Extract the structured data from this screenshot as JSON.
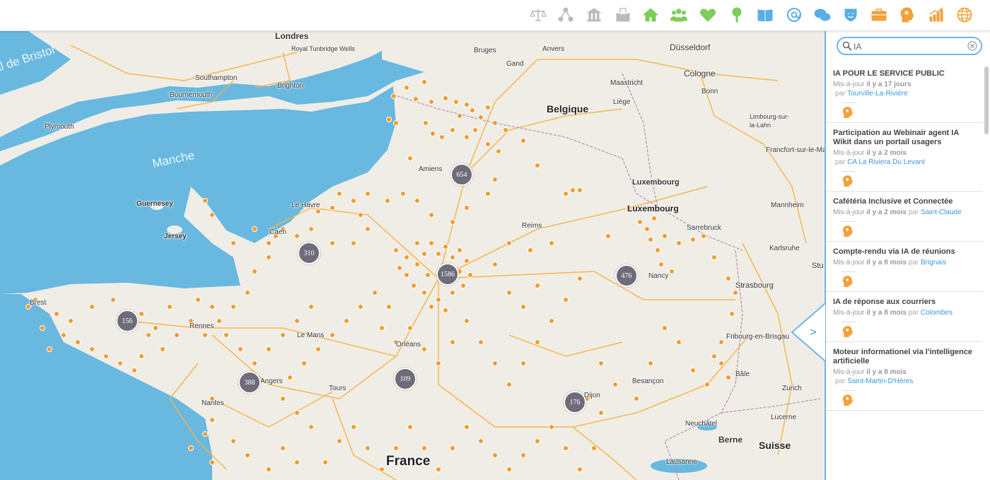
{
  "toolbar": {
    "icons": [
      {
        "name": "justice-scale-icon",
        "color": "#bbbbbb"
      },
      {
        "name": "network-icon",
        "color": "#bbbbbb"
      },
      {
        "name": "institution-icon",
        "color": "#bbbbbb"
      },
      {
        "name": "ballot-box-icon",
        "color": "#bbbbbb"
      },
      {
        "name": "home-icon",
        "color": "#7ccd5a"
      },
      {
        "name": "people-icon",
        "color": "#7ccd5a"
      },
      {
        "name": "handshake-heart-icon",
        "color": "#7ccd5a"
      },
      {
        "name": "tree-icon",
        "color": "#7ccd5a"
      },
      {
        "name": "book-icon",
        "color": "#5aaee6"
      },
      {
        "name": "at-sign-icon",
        "color": "#5aaee6"
      },
      {
        "name": "chat-bubbles-icon",
        "color": "#5aaee6"
      },
      {
        "name": "theater-mask-icon",
        "color": "#5aaee6"
      },
      {
        "name": "briefcase-icon",
        "color": "#f2a13b"
      },
      {
        "name": "brain-head-icon",
        "color": "#f2a13b"
      },
      {
        "name": "growth-chart-icon",
        "color": "#f2a13b"
      },
      {
        "name": "globe-icon",
        "color": "#f2a13b"
      }
    ]
  },
  "colors": {
    "accent": "#6fb6e8",
    "marker": "#f29a2e",
    "cluster": "#6e6b7a",
    "sea": "#68b8e0",
    "land": "#f0ede6",
    "road": "#f5b445",
    "link": "#3a9ad9"
  },
  "map": {
    "sea_labels": [
      "al de Bristol",
      "Manche"
    ],
    "countries": [
      "Belgique",
      "France",
      "Suisse",
      "Luxembourg"
    ],
    "cities": [
      "Londres",
      "Royal Tunbridge Wells",
      "Southampton",
      "Bournemouth",
      "Brighton",
      "Plymouth",
      "Guernesey",
      "Jersey",
      "Bruges",
      "Anvers",
      "Gand",
      "Maastricht",
      "Liège",
      "Düsseldorf",
      "Cologne",
      "Bonn",
      "Limbourg-sur-la-Lahn",
      "Francfort-sur-le-Main",
      "Mannheim",
      "Sarrebruck",
      "Karlsruhe",
      "Stu",
      "Strasbourg",
      "Fribourg-en-Brisgau",
      "Bâle",
      "Zurich",
      "Lucerne",
      "Neuchâtel",
      "Berne",
      "Lausanne",
      "Besançon",
      "Dijon",
      "Nancy",
      "Reims",
      "Amiens",
      "Le Havre",
      "Caen",
      "Rennes",
      "Le Mans",
      "Orléans",
      "Tours",
      "Angers",
      "Nantes",
      "Brest",
      "Luxembourg"
    ],
    "clusters": [
      {
        "label": "654"
      },
      {
        "label": "310"
      },
      {
        "label": "1586"
      },
      {
        "label": "476"
      },
      {
        "label": "156"
      },
      {
        "label": "388"
      },
      {
        "label": "109"
      },
      {
        "label": "176"
      }
    ]
  },
  "panel": {
    "search": {
      "value": "IA",
      "placeholder": ""
    },
    "results": [
      {
        "title": "IA POUR LE SERVICE PUBLIC",
        "updated_label": "Mis-à-jour",
        "ago": "il y a 17 jours",
        "by": "par",
        "place": "Tourville-La-Rivière"
      },
      {
        "title": "Participation au Webinair agent IA Wikit dans un portail usagers",
        "updated_label": "Mis-à-jour",
        "ago": "il y a 2 mois",
        "by": "par",
        "place": "CA La Riviera Du Levant"
      },
      {
        "title": "Cafétéria Inclusive et Connectée",
        "updated_label": "Mis-à-jour",
        "ago": "il y a 2 mois",
        "by": "par",
        "place": "Saint-Claude"
      },
      {
        "title": "Compte-rendu via IA de réunions",
        "updated_label": "Mis-à-jour",
        "ago": "il y a 8 mois",
        "by": "par",
        "place": "Brignais"
      },
      {
        "title": "IA de réponse aux courriers",
        "updated_label": "Mis-à-jour",
        "ago": "il y a 8 mois",
        "by": "par",
        "place": "Colombes"
      },
      {
        "title": "Moteur informationel via l'intelligence artificielle",
        "updated_label": "Mis-à-jour",
        "ago": "il y a 8 mois",
        "by": "par",
        "place": "Saint-Martin-D'Hères"
      }
    ],
    "collapse_label": ">"
  }
}
